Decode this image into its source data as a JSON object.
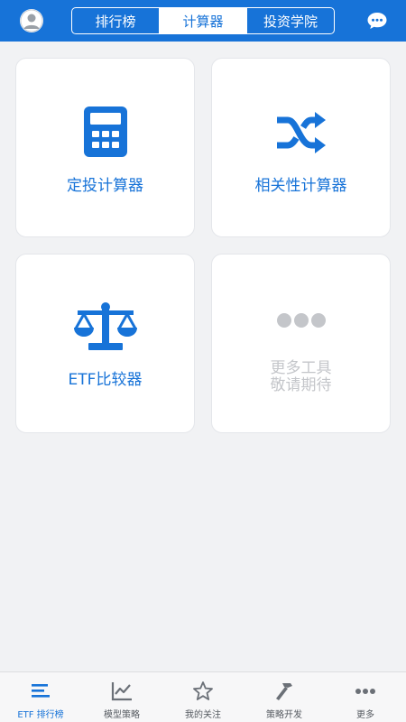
{
  "header": {
    "tabs": [
      {
        "label": "排行榜"
      },
      {
        "label": "计算器"
      },
      {
        "label": "投资学院"
      }
    ],
    "active_tab": "计算器"
  },
  "tools": [
    {
      "label": "定投计算器",
      "icon": "calculator-icon"
    },
    {
      "label": "相关性计算器",
      "icon": "shuffle-icon"
    },
    {
      "label": "ETF比较器",
      "icon": "scale-icon"
    },
    {
      "label_line1": "更多工具",
      "label_line2": "敬请期待",
      "icon": "more-dots-icon"
    }
  ],
  "bottom_nav": [
    {
      "label": "ETF 排行榜",
      "icon": "list-icon"
    },
    {
      "label": "模型策略",
      "icon": "line-chart-icon"
    },
    {
      "label": "我的关注",
      "icon": "star-icon"
    },
    {
      "label": "策略开发",
      "icon": "hammer-icon"
    },
    {
      "label": "更多",
      "icon": "more-horizontal-icon"
    }
  ],
  "colors": {
    "accent": "#1773d8",
    "background": "#f1f2f4",
    "card": "#ffffff",
    "disabled_text": "#c4c6ca"
  }
}
